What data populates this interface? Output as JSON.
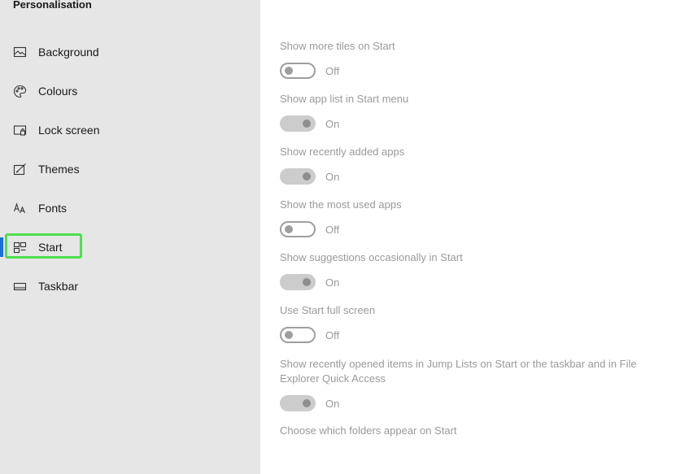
{
  "sidebar": {
    "title": "Personalisation",
    "items": [
      {
        "label": "Background",
        "icon": "image-icon"
      },
      {
        "label": "Colours",
        "icon": "palette-icon"
      },
      {
        "label": "Lock screen",
        "icon": "lock-screen-icon"
      },
      {
        "label": "Themes",
        "icon": "themes-icon"
      },
      {
        "label": "Fonts",
        "icon": "fonts-icon"
      },
      {
        "label": "Start",
        "icon": "start-icon",
        "selected": true
      },
      {
        "label": "Taskbar",
        "icon": "taskbar-icon"
      }
    ]
  },
  "settings": [
    {
      "label": "Show more tiles on Start",
      "state": "Off",
      "on": false
    },
    {
      "label": "Show app list in Start menu",
      "state": "On",
      "on": true
    },
    {
      "label": "Show recently added apps",
      "state": "On",
      "on": true
    },
    {
      "label": "Show the most used apps",
      "state": "Off",
      "on": false
    },
    {
      "label": "Show suggestions occasionally in Start",
      "state": "On",
      "on": true
    },
    {
      "label": "Use Start full screen",
      "state": "Off",
      "on": false
    },
    {
      "label": "Show recently opened items in Jump Lists on Start or the taskbar and in File Explorer Quick Access",
      "state": "On",
      "on": true
    }
  ],
  "folders_link": "Choose which folders appear on Start",
  "colors": {
    "accent": "#1a6fd1",
    "focus_ring": "#4ce04c",
    "sidebar_bg": "#e6e6e6"
  }
}
